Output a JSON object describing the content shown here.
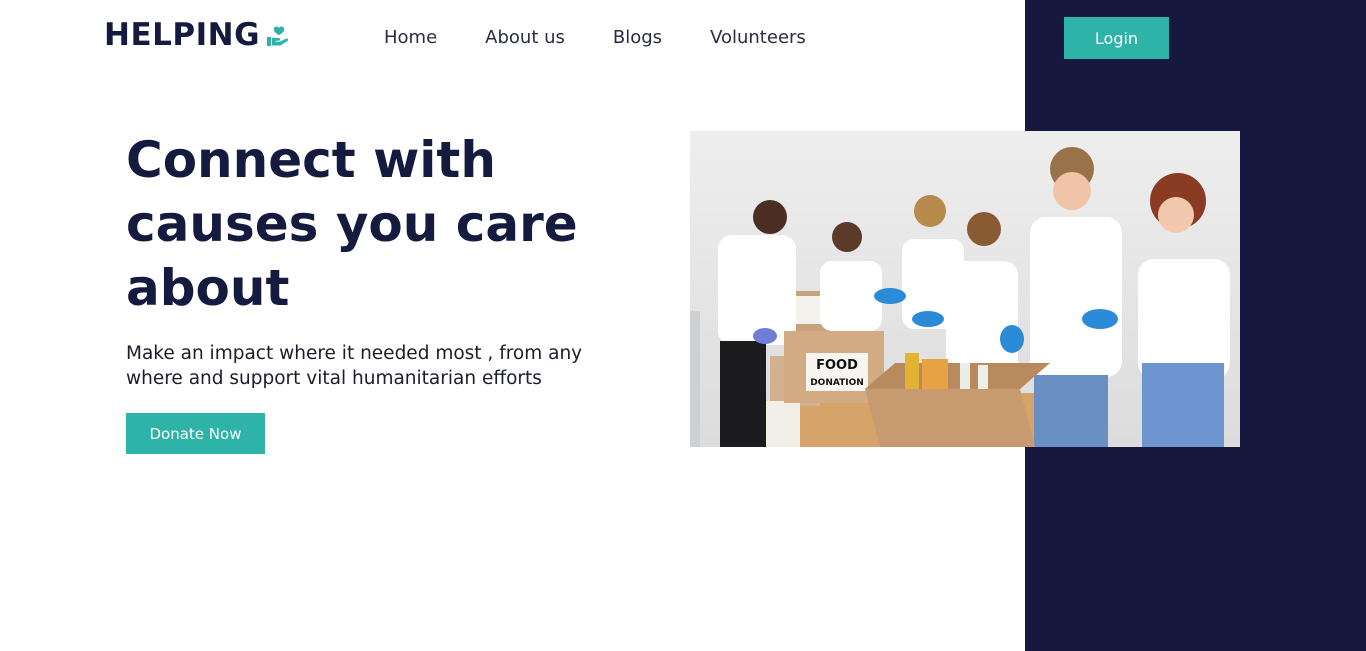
{
  "brand": {
    "name": "HELPING",
    "icon": "heart-hand-icon",
    "colors": {
      "navy": "#161840",
      "teal": "#2db3a7"
    }
  },
  "nav": {
    "items": [
      {
        "label": "Home"
      },
      {
        "label": "About us"
      },
      {
        "label": "Blogs"
      },
      {
        "label": "Volunteers"
      }
    ]
  },
  "header": {
    "login_label": "Login"
  },
  "hero": {
    "title": "Connect with causes you care about",
    "subtitle": "Make an impact where it needed most , from any where and support vital humanitarian efforts",
    "cta_label": "Donate Now",
    "photo": {
      "box_label_1": "FOOD",
      "box_label_2": "DONATION"
    }
  }
}
